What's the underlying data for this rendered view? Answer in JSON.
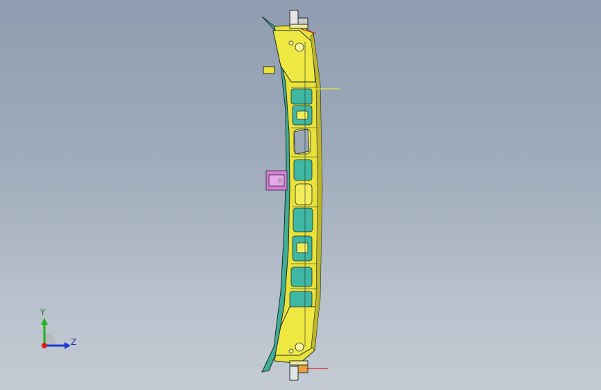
{
  "viewport": {
    "background_top": "#8f9db0",
    "background_bottom": "#c4cbd4"
  },
  "model": {
    "part_colors": {
      "body": "#e9e23a",
      "body_shade": "#bdb52a",
      "inner": "#3fb8a3",
      "bracket": "#d77bd8",
      "edge": "#1f2a2a"
    }
  },
  "triad": {
    "y_label": "Y",
    "z_label": "Z",
    "colors": {
      "y": "#1db31d",
      "z": "#1a3ad6",
      "x": "#d62020"
    }
  }
}
